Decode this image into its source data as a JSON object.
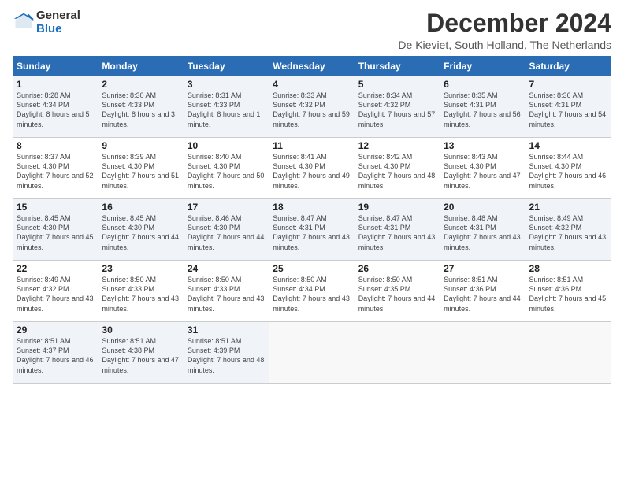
{
  "logo": {
    "general": "General",
    "blue": "Blue"
  },
  "title": "December 2024",
  "subtitle": "De Kieviet, South Holland, The Netherlands",
  "headers": [
    "Sunday",
    "Monday",
    "Tuesday",
    "Wednesday",
    "Thursday",
    "Friday",
    "Saturday"
  ],
  "weeks": [
    [
      {
        "day": "1",
        "sunrise": "Sunrise: 8:28 AM",
        "sunset": "Sunset: 4:34 PM",
        "daylight": "Daylight: 8 hours and 5 minutes."
      },
      {
        "day": "2",
        "sunrise": "Sunrise: 8:30 AM",
        "sunset": "Sunset: 4:33 PM",
        "daylight": "Daylight: 8 hours and 3 minutes."
      },
      {
        "day": "3",
        "sunrise": "Sunrise: 8:31 AM",
        "sunset": "Sunset: 4:33 PM",
        "daylight": "Daylight: 8 hours and 1 minute."
      },
      {
        "day": "4",
        "sunrise": "Sunrise: 8:33 AM",
        "sunset": "Sunset: 4:32 PM",
        "daylight": "Daylight: 7 hours and 59 minutes."
      },
      {
        "day": "5",
        "sunrise": "Sunrise: 8:34 AM",
        "sunset": "Sunset: 4:32 PM",
        "daylight": "Daylight: 7 hours and 57 minutes."
      },
      {
        "day": "6",
        "sunrise": "Sunrise: 8:35 AM",
        "sunset": "Sunset: 4:31 PM",
        "daylight": "Daylight: 7 hours and 56 minutes."
      },
      {
        "day": "7",
        "sunrise": "Sunrise: 8:36 AM",
        "sunset": "Sunset: 4:31 PM",
        "daylight": "Daylight: 7 hours and 54 minutes."
      }
    ],
    [
      {
        "day": "8",
        "sunrise": "Sunrise: 8:37 AM",
        "sunset": "Sunset: 4:30 PM",
        "daylight": "Daylight: 7 hours and 52 minutes."
      },
      {
        "day": "9",
        "sunrise": "Sunrise: 8:39 AM",
        "sunset": "Sunset: 4:30 PM",
        "daylight": "Daylight: 7 hours and 51 minutes."
      },
      {
        "day": "10",
        "sunrise": "Sunrise: 8:40 AM",
        "sunset": "Sunset: 4:30 PM",
        "daylight": "Daylight: 7 hours and 50 minutes."
      },
      {
        "day": "11",
        "sunrise": "Sunrise: 8:41 AM",
        "sunset": "Sunset: 4:30 PM",
        "daylight": "Daylight: 7 hours and 49 minutes."
      },
      {
        "day": "12",
        "sunrise": "Sunrise: 8:42 AM",
        "sunset": "Sunset: 4:30 PM",
        "daylight": "Daylight: 7 hours and 48 minutes."
      },
      {
        "day": "13",
        "sunrise": "Sunrise: 8:43 AM",
        "sunset": "Sunset: 4:30 PM",
        "daylight": "Daylight: 7 hours and 47 minutes."
      },
      {
        "day": "14",
        "sunrise": "Sunrise: 8:44 AM",
        "sunset": "Sunset: 4:30 PM",
        "daylight": "Daylight: 7 hours and 46 minutes."
      }
    ],
    [
      {
        "day": "15",
        "sunrise": "Sunrise: 8:45 AM",
        "sunset": "Sunset: 4:30 PM",
        "daylight": "Daylight: 7 hours and 45 minutes."
      },
      {
        "day": "16",
        "sunrise": "Sunrise: 8:45 AM",
        "sunset": "Sunset: 4:30 PM",
        "daylight": "Daylight: 7 hours and 44 minutes."
      },
      {
        "day": "17",
        "sunrise": "Sunrise: 8:46 AM",
        "sunset": "Sunset: 4:30 PM",
        "daylight": "Daylight: 7 hours and 44 minutes."
      },
      {
        "day": "18",
        "sunrise": "Sunrise: 8:47 AM",
        "sunset": "Sunset: 4:31 PM",
        "daylight": "Daylight: 7 hours and 43 minutes."
      },
      {
        "day": "19",
        "sunrise": "Sunrise: 8:47 AM",
        "sunset": "Sunset: 4:31 PM",
        "daylight": "Daylight: 7 hours and 43 minutes."
      },
      {
        "day": "20",
        "sunrise": "Sunrise: 8:48 AM",
        "sunset": "Sunset: 4:31 PM",
        "daylight": "Daylight: 7 hours and 43 minutes."
      },
      {
        "day": "21",
        "sunrise": "Sunrise: 8:49 AM",
        "sunset": "Sunset: 4:32 PM",
        "daylight": "Daylight: 7 hours and 43 minutes."
      }
    ],
    [
      {
        "day": "22",
        "sunrise": "Sunrise: 8:49 AM",
        "sunset": "Sunset: 4:32 PM",
        "daylight": "Daylight: 7 hours and 43 minutes."
      },
      {
        "day": "23",
        "sunrise": "Sunrise: 8:50 AM",
        "sunset": "Sunset: 4:33 PM",
        "daylight": "Daylight: 7 hours and 43 minutes."
      },
      {
        "day": "24",
        "sunrise": "Sunrise: 8:50 AM",
        "sunset": "Sunset: 4:33 PM",
        "daylight": "Daylight: 7 hours and 43 minutes."
      },
      {
        "day": "25",
        "sunrise": "Sunrise: 8:50 AM",
        "sunset": "Sunset: 4:34 PM",
        "daylight": "Daylight: 7 hours and 43 minutes."
      },
      {
        "day": "26",
        "sunrise": "Sunrise: 8:50 AM",
        "sunset": "Sunset: 4:35 PM",
        "daylight": "Daylight: 7 hours and 44 minutes."
      },
      {
        "day": "27",
        "sunrise": "Sunrise: 8:51 AM",
        "sunset": "Sunset: 4:36 PM",
        "daylight": "Daylight: 7 hours and 44 minutes."
      },
      {
        "day": "28",
        "sunrise": "Sunrise: 8:51 AM",
        "sunset": "Sunset: 4:36 PM",
        "daylight": "Daylight: 7 hours and 45 minutes."
      }
    ],
    [
      {
        "day": "29",
        "sunrise": "Sunrise: 8:51 AM",
        "sunset": "Sunset: 4:37 PM",
        "daylight": "Daylight: 7 hours and 46 minutes."
      },
      {
        "day": "30",
        "sunrise": "Sunrise: 8:51 AM",
        "sunset": "Sunset: 4:38 PM",
        "daylight": "Daylight: 7 hours and 47 minutes."
      },
      {
        "day": "31",
        "sunrise": "Sunrise: 8:51 AM",
        "sunset": "Sunset: 4:39 PM",
        "daylight": "Daylight: 7 hours and 48 minutes."
      },
      null,
      null,
      null,
      null
    ]
  ]
}
